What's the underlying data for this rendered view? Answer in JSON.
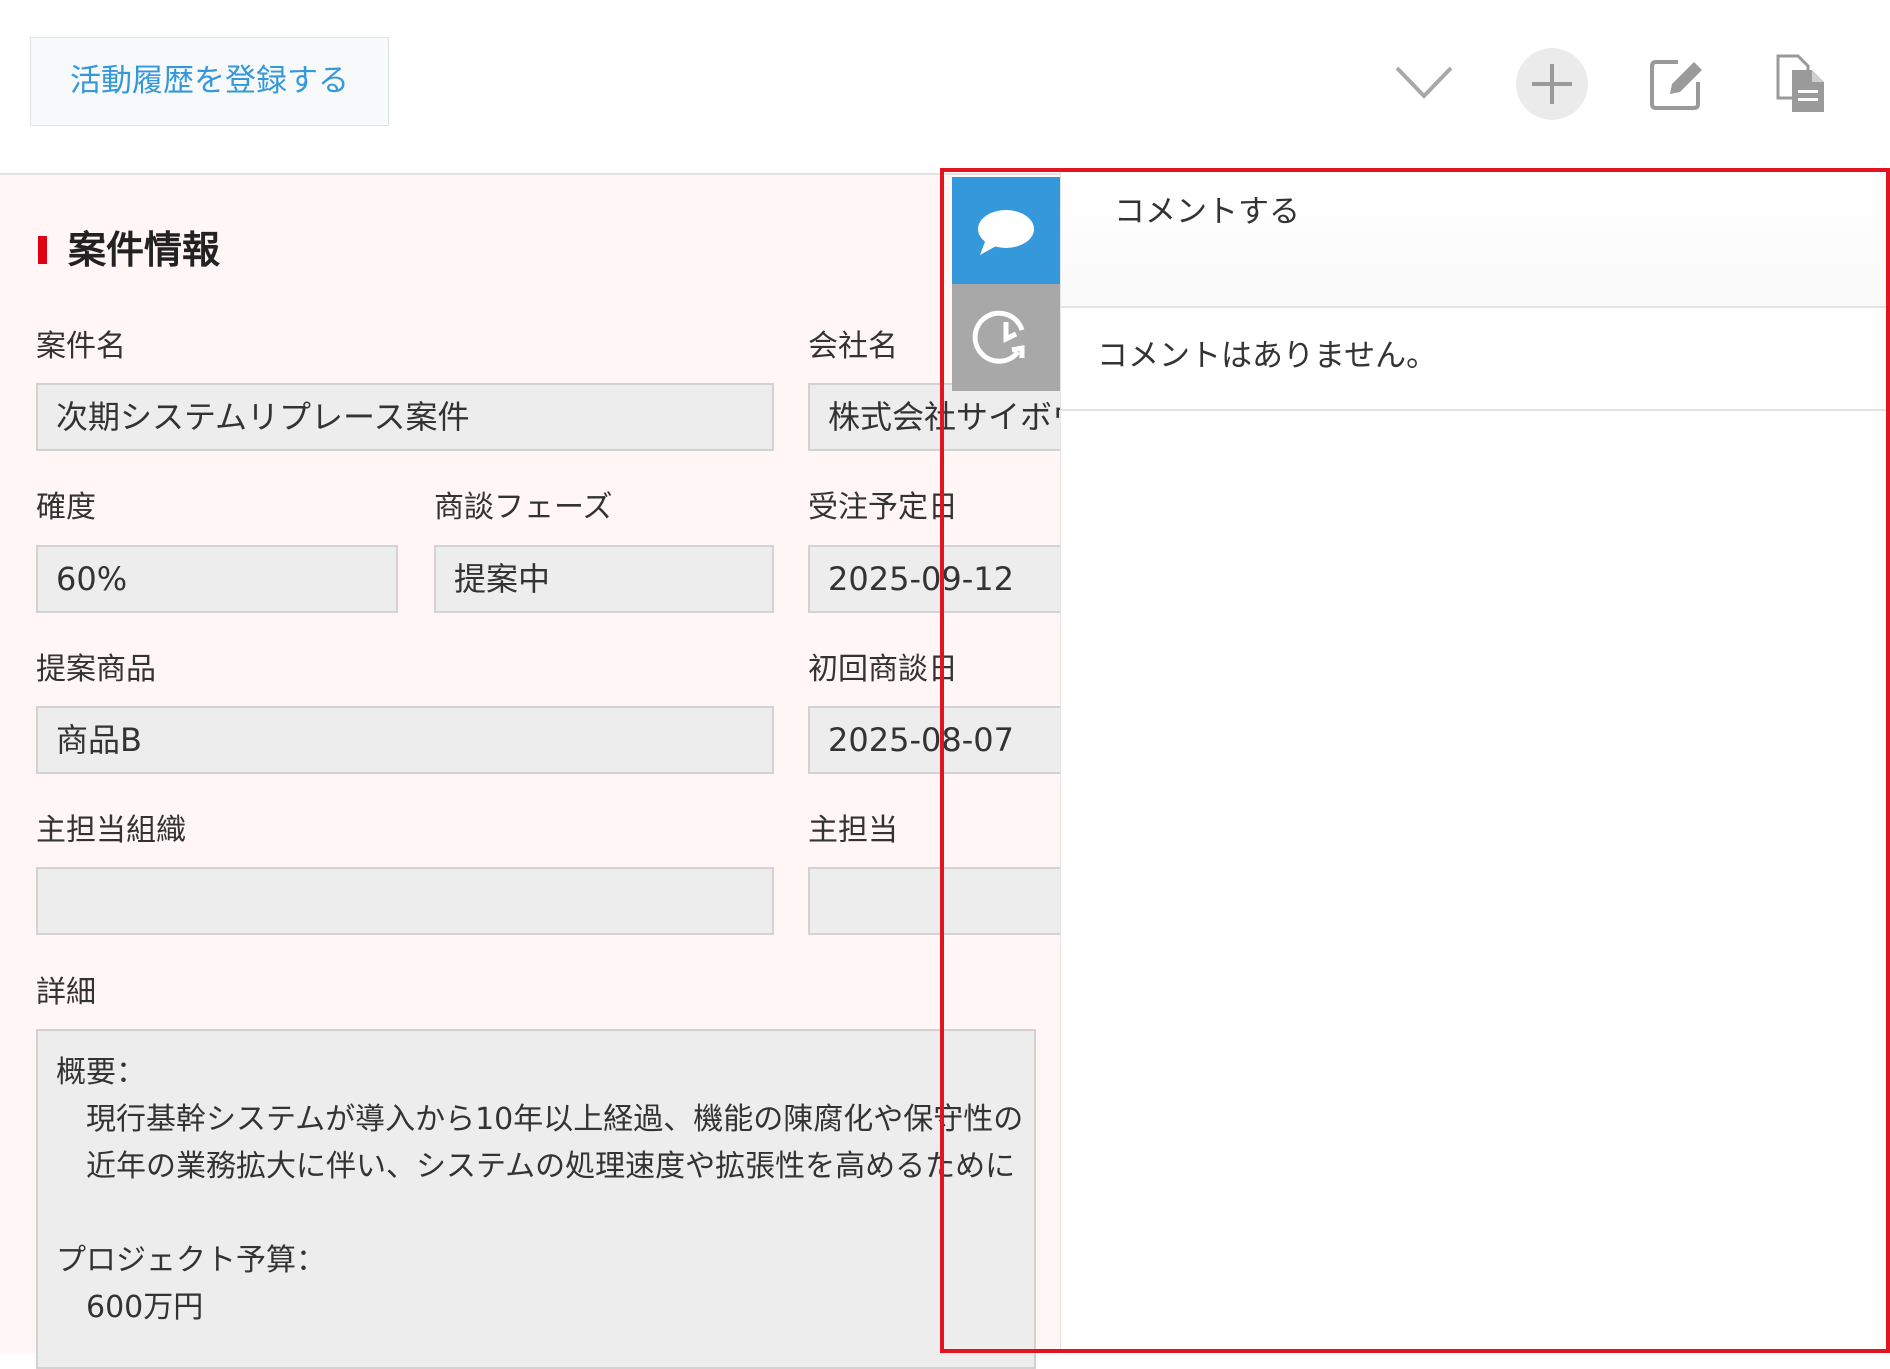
{
  "toolbar": {
    "register_label": "活動履歴を登録する",
    "icons": [
      "chevron-down-icon",
      "plus-icon",
      "edit-icon",
      "copy-icon"
    ]
  },
  "record": {
    "section_title": "案件情報",
    "fields": {
      "deal_name": {
        "label": "案件名",
        "value": "次期システムリプレース案件"
      },
      "company_name": {
        "label": "会社名",
        "value": "株式会社サイボウズ"
      },
      "probability": {
        "label": "確度",
        "value": "60%"
      },
      "phase": {
        "label": "商談フェーズ",
        "value": "提案中"
      },
      "expected_order_date": {
        "label": "受注予定日",
        "value": "2025-09-12"
      },
      "product": {
        "label": "提案商品",
        "value": "商品B"
      },
      "first_meeting_date": {
        "label": "初回商談日",
        "value": "2025-08-07"
      },
      "owner_org": {
        "label": "主担当組織",
        "value": ""
      },
      "owner": {
        "label": "主担当",
        "value": ""
      },
      "details": {
        "label": "詳細",
        "value": "概要：\n　現行基幹システムが導入から10年以上経過、機能の陳腐化や保守性の\n　近年の業務拡大に伴い、システムの処理速度や拡張性を高めるために\n\nプロジェクト予算：\n　600万円"
      }
    }
  },
  "side_panel": {
    "tabs": [
      "comment-tab",
      "history-tab"
    ],
    "comment_placeholder": "コメントする",
    "empty_message": "コメントはありません。"
  },
  "colors": {
    "accent": "#3498db",
    "highlight_border": "#e2141f",
    "section_marker": "#e00012",
    "record_background": "#fff6f5"
  }
}
